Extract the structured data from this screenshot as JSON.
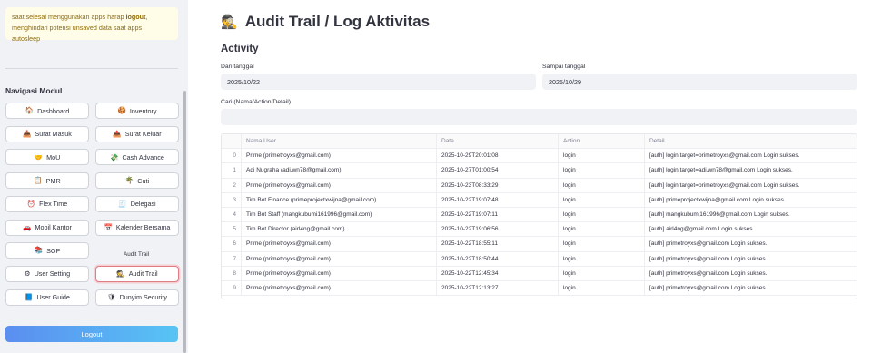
{
  "sidebar": {
    "notice_prefix": "saat selesai menggunakan apps harap ",
    "notice_bold": "logout",
    "notice_suffix": ", menghindari potensi unsaved data saat apps autosleep",
    "nav_title": "Navigasi Modul",
    "nav_items": [
      {
        "label": "Dashboard",
        "icon": "🏠",
        "icon_name": "house-icon"
      },
      {
        "label": "Inventory",
        "icon": "🍪",
        "icon_name": "cookie-icon"
      },
      {
        "label": "Surat Masuk",
        "icon": "📥",
        "icon_name": "inbox-icon"
      },
      {
        "label": "Surat Keluar",
        "icon": "📤",
        "icon_name": "outbox-icon"
      },
      {
        "label": "MoU",
        "icon": "🤝",
        "icon_name": "handshake-icon"
      },
      {
        "label": "Cash Advance",
        "icon": "💸",
        "icon_name": "money-icon"
      },
      {
        "label": "PMR",
        "icon": "📋",
        "icon_name": "clipboard-icon"
      },
      {
        "label": "Cuti",
        "icon": "🌴",
        "icon_name": "palm-tree-icon"
      },
      {
        "label": "Flex Time",
        "icon": "⏰",
        "icon_name": "alarm-clock-icon"
      },
      {
        "label": "Delegasi",
        "icon": "🧾",
        "icon_name": "receipt-icon"
      },
      {
        "label": "Mobil Kantor",
        "icon": "🚗",
        "icon_name": "car-icon"
      },
      {
        "label": "Kalender Bersama",
        "icon": "📅",
        "icon_name": "calendar-icon"
      },
      {
        "label": "SOP",
        "icon": "📚",
        "icon_name": "books-icon"
      },
      {
        "label": "",
        "icon": "",
        "icon_name": ""
      },
      {
        "label": "User Setting",
        "icon": "⚙",
        "icon_name": "gear-icon"
      },
      {
        "label": "Audit Trail",
        "icon": "🕵",
        "icon_name": "detective-icon",
        "active": true
      },
      {
        "label": "User Guide",
        "icon": "📘",
        "icon_name": "book-icon"
      },
      {
        "label": "Dunyim Security",
        "icon": "🛡",
        "icon_name": "shield-icon"
      }
    ],
    "tooltip": "Audit Trail",
    "logout_label": "Logout"
  },
  "main": {
    "title": "Audit Trail / Log Aktivitas",
    "title_icon": "🕵",
    "section": "Activity",
    "from_label": "Dari tanggal",
    "from_value": "2025/10/22",
    "to_label": "Sampai tanggal",
    "to_value": "2025/10/29",
    "search_label": "Cari (Nama/Action/Detail)",
    "search_value": ""
  },
  "table": {
    "headers": [
      "",
      "Nama User",
      "Date",
      "Action",
      "Detail"
    ],
    "rows": [
      [
        "0",
        "Prime (primetroyxs@gmail.com)",
        "2025-10-29T20:01:08",
        "login",
        "[auth] login target=primetroyxs@gmail.com Login sukses."
      ],
      [
        "1",
        "Adi Nugraha (adi.wn78@gmail.com)",
        "2025-10-27T01:00:54",
        "login",
        "[auth] login target=adi.wn78@gmail.com Login sukses."
      ],
      [
        "2",
        "Prime (primetroyxs@gmail.com)",
        "2025-10-23T08:33:29",
        "login",
        "[auth] login target=primetroyxs@gmail.com Login sukses."
      ],
      [
        "3",
        "Tim Bot Finance (primeprojectxwijna@gmail.com)",
        "2025-10-22T19:07:48",
        "login",
        "[auth] primeprojectxwijna@gmail.com Login sukses."
      ],
      [
        "4",
        "Tim Bot Staff (mangkubumi161996@gmail.com)",
        "2025-10-22T19:07:11",
        "login",
        "[auth] mangkubumi161996@gmail.com Login sukses."
      ],
      [
        "5",
        "Tim Bot Director (airl4ng@gmail.com)",
        "2025-10-22T19:06:56",
        "login",
        "[auth] airl4ng@gmail.com Login sukses."
      ],
      [
        "6",
        "Prime (primetroyxs@gmail.com)",
        "2025-10-22T18:55:11",
        "login",
        "[auth] primetroyxs@gmail.com Login sukses."
      ],
      [
        "7",
        "Prime (primetroyxs@gmail.com)",
        "2025-10-22T18:50:44",
        "login",
        "[auth] primetroyxs@gmail.com Login sukses."
      ],
      [
        "8",
        "Prime (primetroyxs@gmail.com)",
        "2025-10-22T12:45:34",
        "login",
        "[auth] primetroyxs@gmail.com Login sukses."
      ],
      [
        "9",
        "Prime (primetroyxs@gmail.com)",
        "2025-10-22T12:13:27",
        "login",
        "[auth] primetroyxs@gmail.com Login sukses."
      ]
    ]
  }
}
